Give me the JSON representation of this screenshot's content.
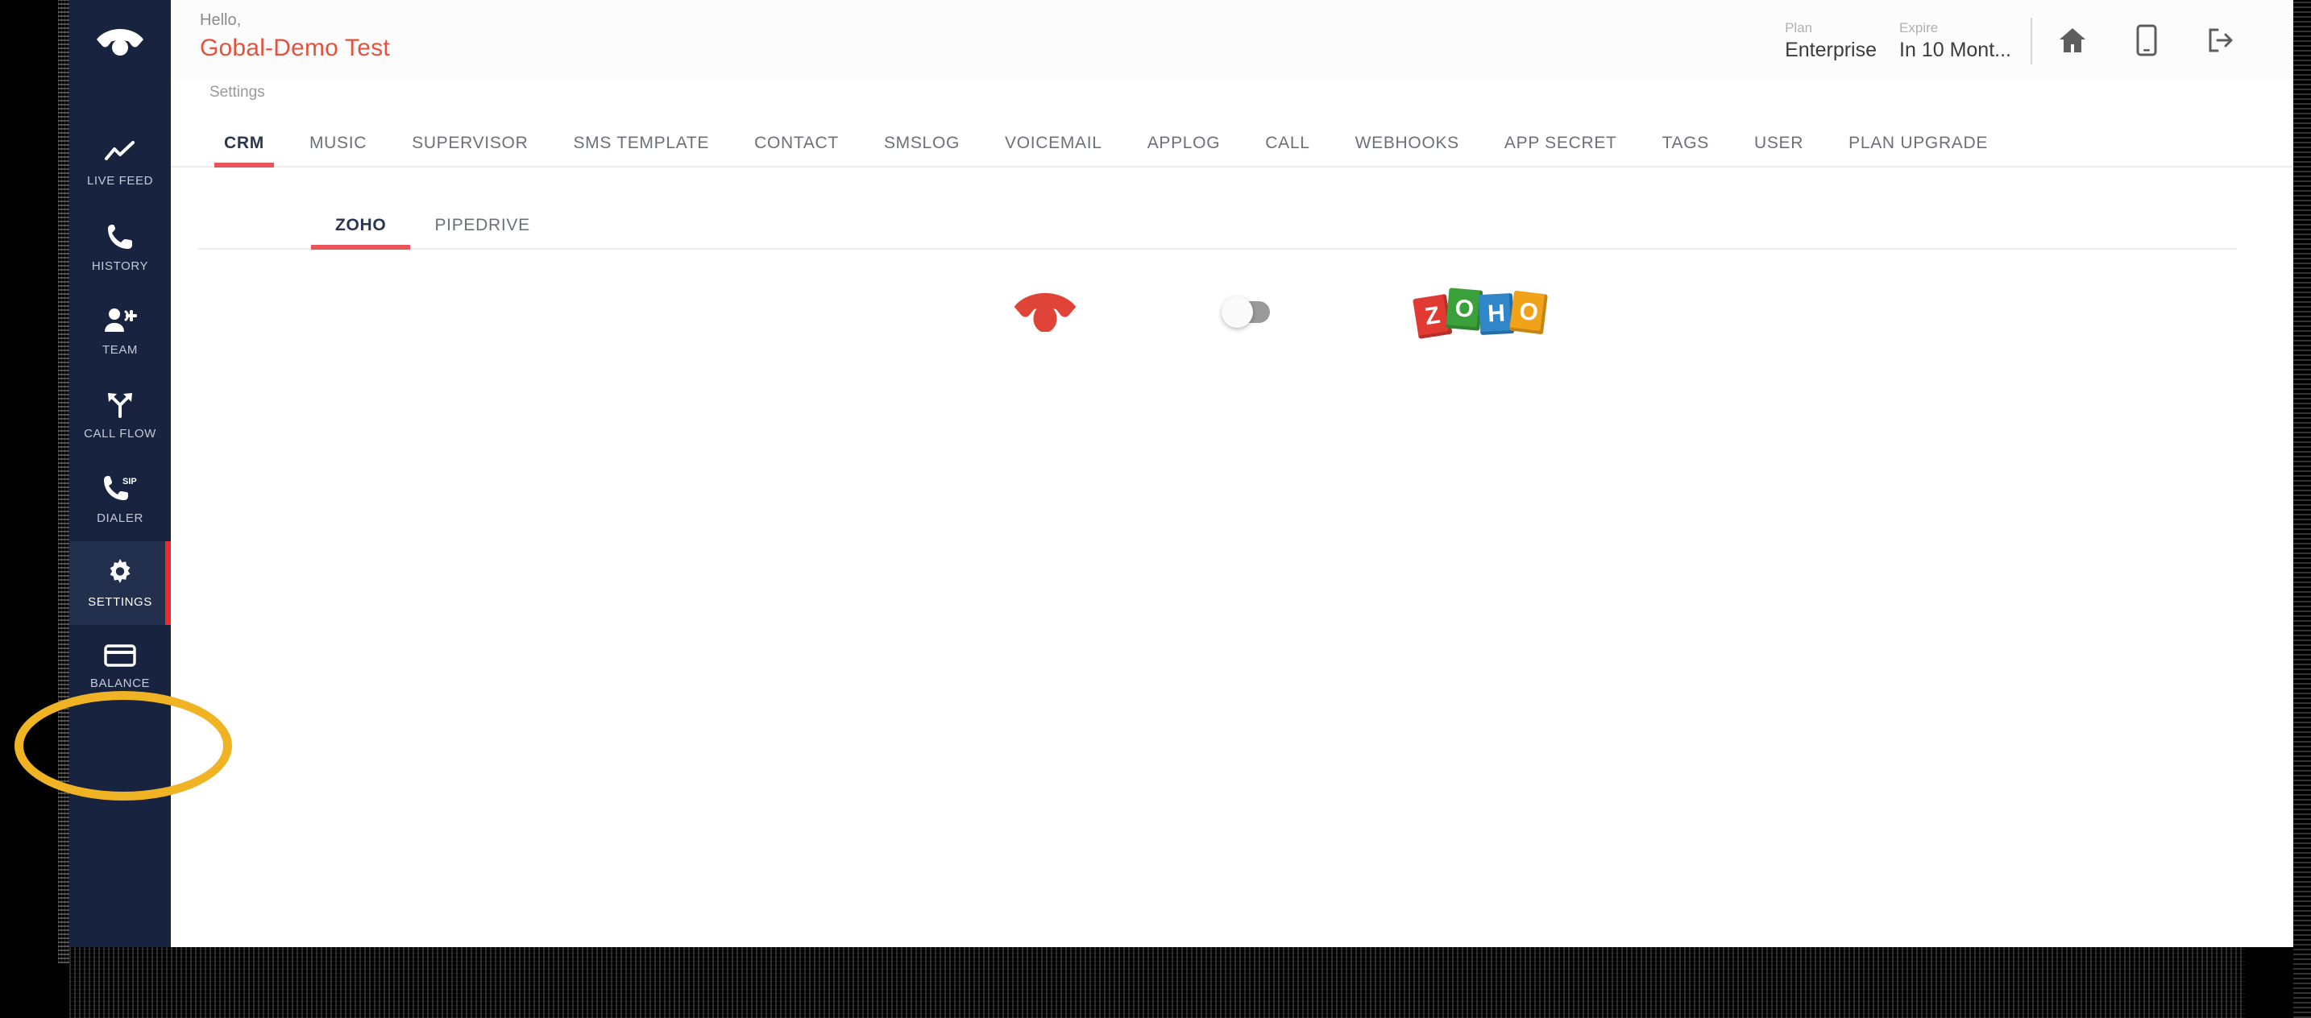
{
  "sidebar": {
    "logo_icon": "hangup-phone-icon",
    "items": [
      {
        "label": "LIVE FEED",
        "icon": "trending-line-icon",
        "active": false
      },
      {
        "label": "HISTORY",
        "icon": "phone-icon",
        "active": false
      },
      {
        "label": "TEAM",
        "icon": "person-add-icon",
        "active": false
      },
      {
        "label": "CALL FLOW",
        "icon": "call-split-icon",
        "active": false
      },
      {
        "label": "DIALER",
        "icon": "sip-phone-icon",
        "active": false
      },
      {
        "label": "SETTINGS",
        "icon": "gear-icon",
        "active": true
      },
      {
        "label": "BALANCE",
        "icon": "credit-card-icon",
        "active": false
      }
    ]
  },
  "header": {
    "hello": "Hello,",
    "account_name": "Gobal-Demo Test",
    "plan_label": "Plan",
    "plan_value": "Enterprise",
    "expire_label": "Expire",
    "expire_value": "In 10 Mont...",
    "icons": [
      "home-icon",
      "mobile-icon",
      "logout-icon"
    ]
  },
  "breadcrumb": "Settings",
  "tabs": [
    {
      "label": "CRM",
      "active": true
    },
    {
      "label": "MUSIC",
      "active": false
    },
    {
      "label": "SUPERVISOR",
      "active": false
    },
    {
      "label": "SMS TEMPLATE",
      "active": false
    },
    {
      "label": "CONTACT",
      "active": false
    },
    {
      "label": "SMSLOG",
      "active": false
    },
    {
      "label": "VOICEMAIL",
      "active": false
    },
    {
      "label": "APPLOG",
      "active": false
    },
    {
      "label": "CALL",
      "active": false
    },
    {
      "label": "WEBHOOKS",
      "active": false
    },
    {
      "label": "APP SECRET",
      "active": false
    },
    {
      "label": "TAGS",
      "active": false
    },
    {
      "label": "USER",
      "active": false
    },
    {
      "label": "PLAN UPGRADE",
      "active": false
    }
  ],
  "subtabs": [
    {
      "label": "ZOHO",
      "active": true
    },
    {
      "label": "PIPEDRIVE",
      "active": false
    }
  ],
  "integration": {
    "app_icon": "hangup-phone-icon",
    "toggle_state": "off",
    "crm_logo": "zoho-logo",
    "zoho_letters": [
      "Z",
      "O",
      "H",
      "O"
    ]
  },
  "annotation": {
    "shape": "ellipse-highlight",
    "target": "sidebar-item-settings",
    "color": "#f0b323"
  },
  "colors": {
    "sidebar_bg": "#18233f",
    "sidebar_active_bg": "#22304e",
    "accent_red": "#e9565a",
    "account_red": "#e1533f",
    "active_indicator": "#ee2b2b"
  }
}
